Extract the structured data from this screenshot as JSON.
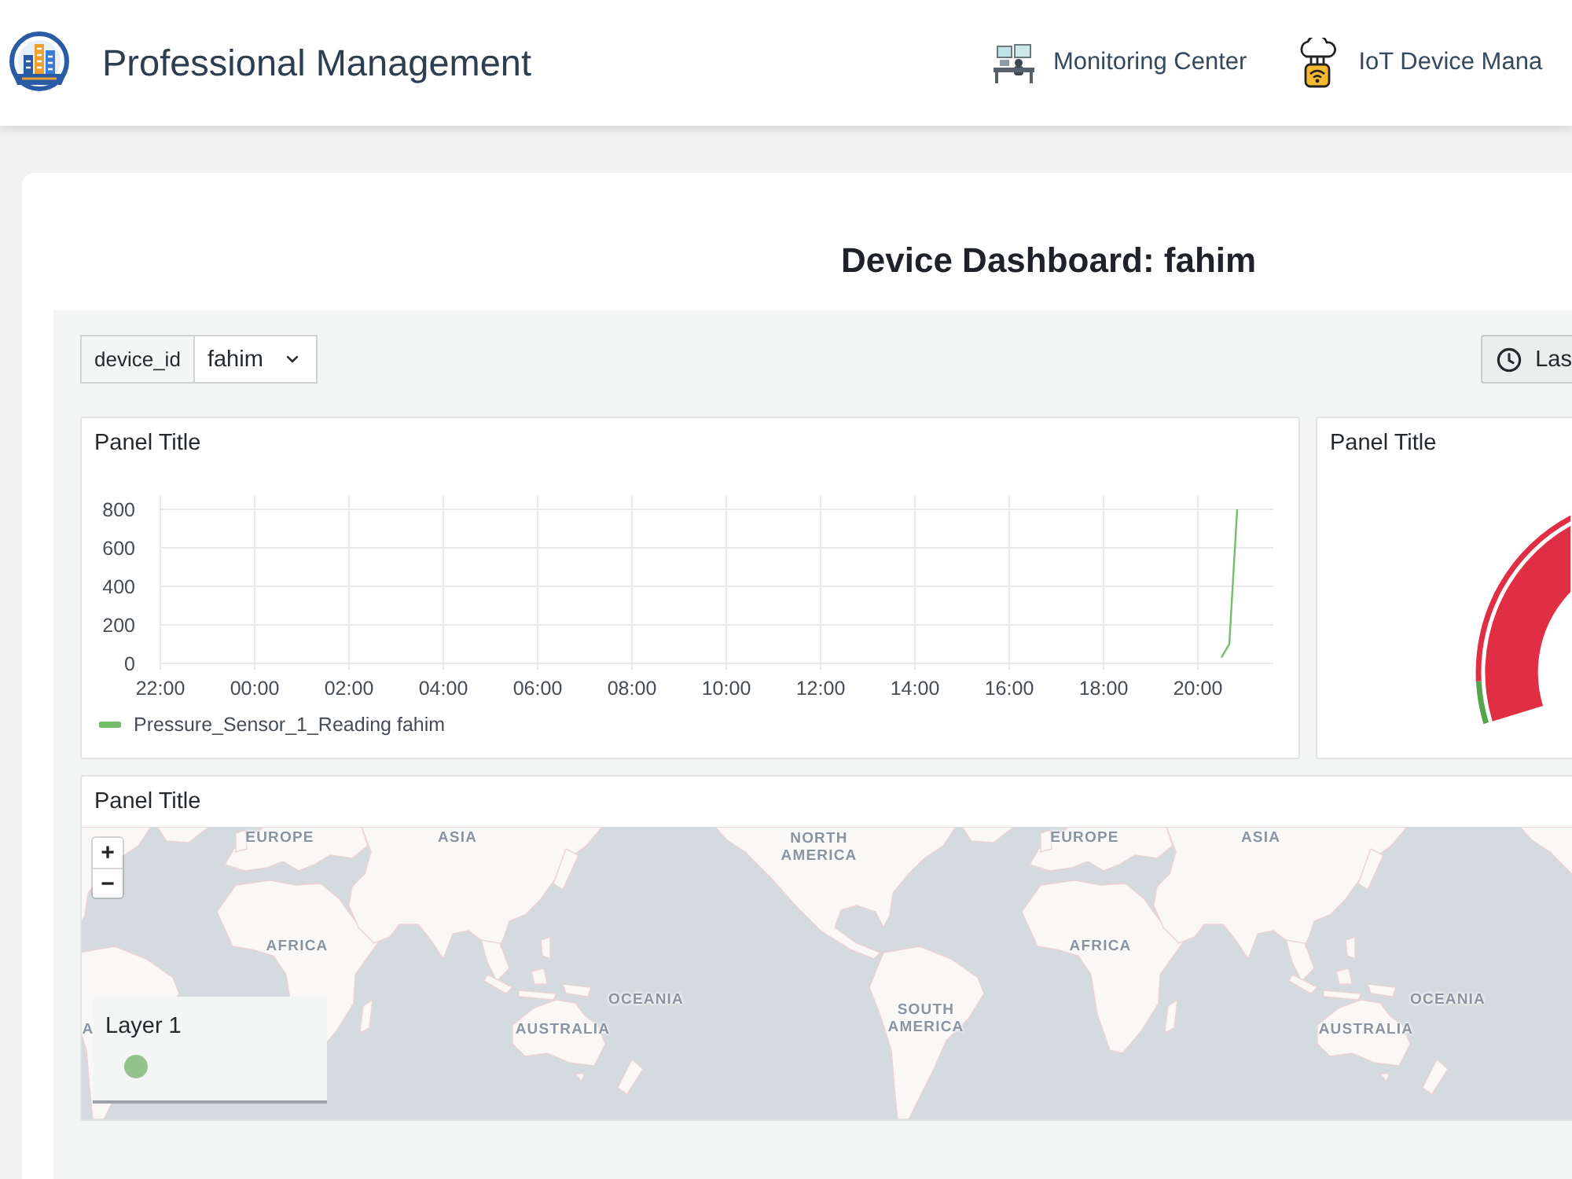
{
  "header": {
    "title": "Professional Management",
    "nav": [
      {
        "kind": "monitor",
        "label": "Monitoring Center"
      },
      {
        "kind": "iot",
        "label": "IoT Device Mana"
      }
    ]
  },
  "dashboard": {
    "title": "Device Dashboard: fahim",
    "variable": {
      "label": "device_id",
      "value": "fahim"
    },
    "time_range": {
      "label": "Las"
    }
  },
  "panels": [
    {
      "kind": "timeseries",
      "title": "Panel Title",
      "chart_data": {
        "type": "line",
        "grid": true,
        "categories": [
          "22:00",
          null,
          null,
          null,
          null,
          null,
          null,
          null,
          null,
          null,
          null,
          null,
          "00:00",
          null,
          null,
          null,
          null,
          null,
          null,
          null,
          null,
          null,
          null,
          null,
          "02:00",
          null,
          null,
          null,
          null,
          null,
          null,
          null,
          null,
          null,
          null,
          null,
          "04:00",
          null,
          null,
          null,
          null,
          null,
          null,
          null,
          null,
          null,
          null,
          null,
          "06:00",
          null,
          null,
          null,
          null,
          null,
          null,
          null,
          null,
          null,
          null,
          null,
          "08:00",
          null,
          null,
          null,
          null,
          null,
          null,
          null,
          null,
          null,
          null,
          null,
          "10:00",
          null,
          null,
          null,
          null,
          null,
          null,
          null,
          null,
          null,
          null,
          null,
          "12:00",
          null,
          null,
          null,
          null,
          null,
          null,
          null,
          null,
          null,
          null,
          null,
          "14:00",
          null,
          null,
          null,
          null,
          null,
          null,
          null,
          null,
          null,
          null,
          null,
          "16:00",
          null,
          null,
          null,
          null,
          null,
          null,
          null,
          null,
          null,
          null,
          null,
          "18:00",
          null,
          null,
          null,
          null,
          null,
          null,
          null,
          null,
          null,
          null,
          null,
          "20:00",
          null,
          null,
          null,
          null,
          null,
          null,
          null,
          null,
          null
        ],
        "ylim": [
          0,
          870
        ],
        "yticks": [
          0,
          200,
          400,
          600,
          800
        ],
        "series": [
          {
            "name": "Pressure_Sensor_1_Reading fahim",
            "color": "#73bf69",
            "values": [
              null,
              null,
              null,
              null,
              null,
              null,
              null,
              null,
              null,
              null,
              null,
              null,
              null,
              null,
              null,
              null,
              null,
              null,
              null,
              null,
              null,
              null,
              null,
              null,
              null,
              null,
              null,
              null,
              null,
              null,
              null,
              null,
              null,
              null,
              null,
              null,
              null,
              null,
              null,
              null,
              null,
              null,
              null,
              null,
              null,
              null,
              null,
              null,
              null,
              null,
              null,
              null,
              null,
              null,
              null,
              null,
              null,
              null,
              null,
              null,
              null,
              null,
              null,
              null,
              null,
              null,
              null,
              null,
              null,
              null,
              null,
              null,
              null,
              null,
              null,
              null,
              null,
              null,
              null,
              null,
              null,
              null,
              null,
              null,
              null,
              null,
              null,
              null,
              null,
              null,
              null,
              null,
              null,
              null,
              null,
              null,
              null,
              null,
              null,
              null,
              null,
              null,
              null,
              null,
              null,
              null,
              null,
              null,
              null,
              null,
              null,
              null,
              null,
              null,
              null,
              null,
              null,
              null,
              null,
              null,
              null,
              null,
              null,
              null,
              null,
              null,
              null,
              null,
              null,
              null,
              null,
              null,
              null,
              null,
              null,
              30,
              100,
              800,
              null,
              null,
              null,
              null
            ]
          }
        ]
      }
    },
    {
      "kind": "gauge",
      "title": "Panel Title"
    },
    {
      "kind": "geomap",
      "title": "Panel Title",
      "zoom_controls": [
        {
          "kind": "zoom_in",
          "label": "+"
        },
        {
          "kind": "zoom_out",
          "label": "−"
        }
      ],
      "map_labels": [
        "EUROPE",
        "ASIA",
        "NORTH AMERICA",
        "EUROPE",
        "ASIA",
        "AFRICA",
        "AFRICA",
        "OCEANIA",
        "OCEANIA",
        "A",
        "AUSTRALIA",
        "SOUTH AMERICA",
        "AUSTRALIA"
      ],
      "layers": [
        {
          "name": "Layer 1",
          "color": "#94c28c"
        }
      ]
    }
  ]
}
